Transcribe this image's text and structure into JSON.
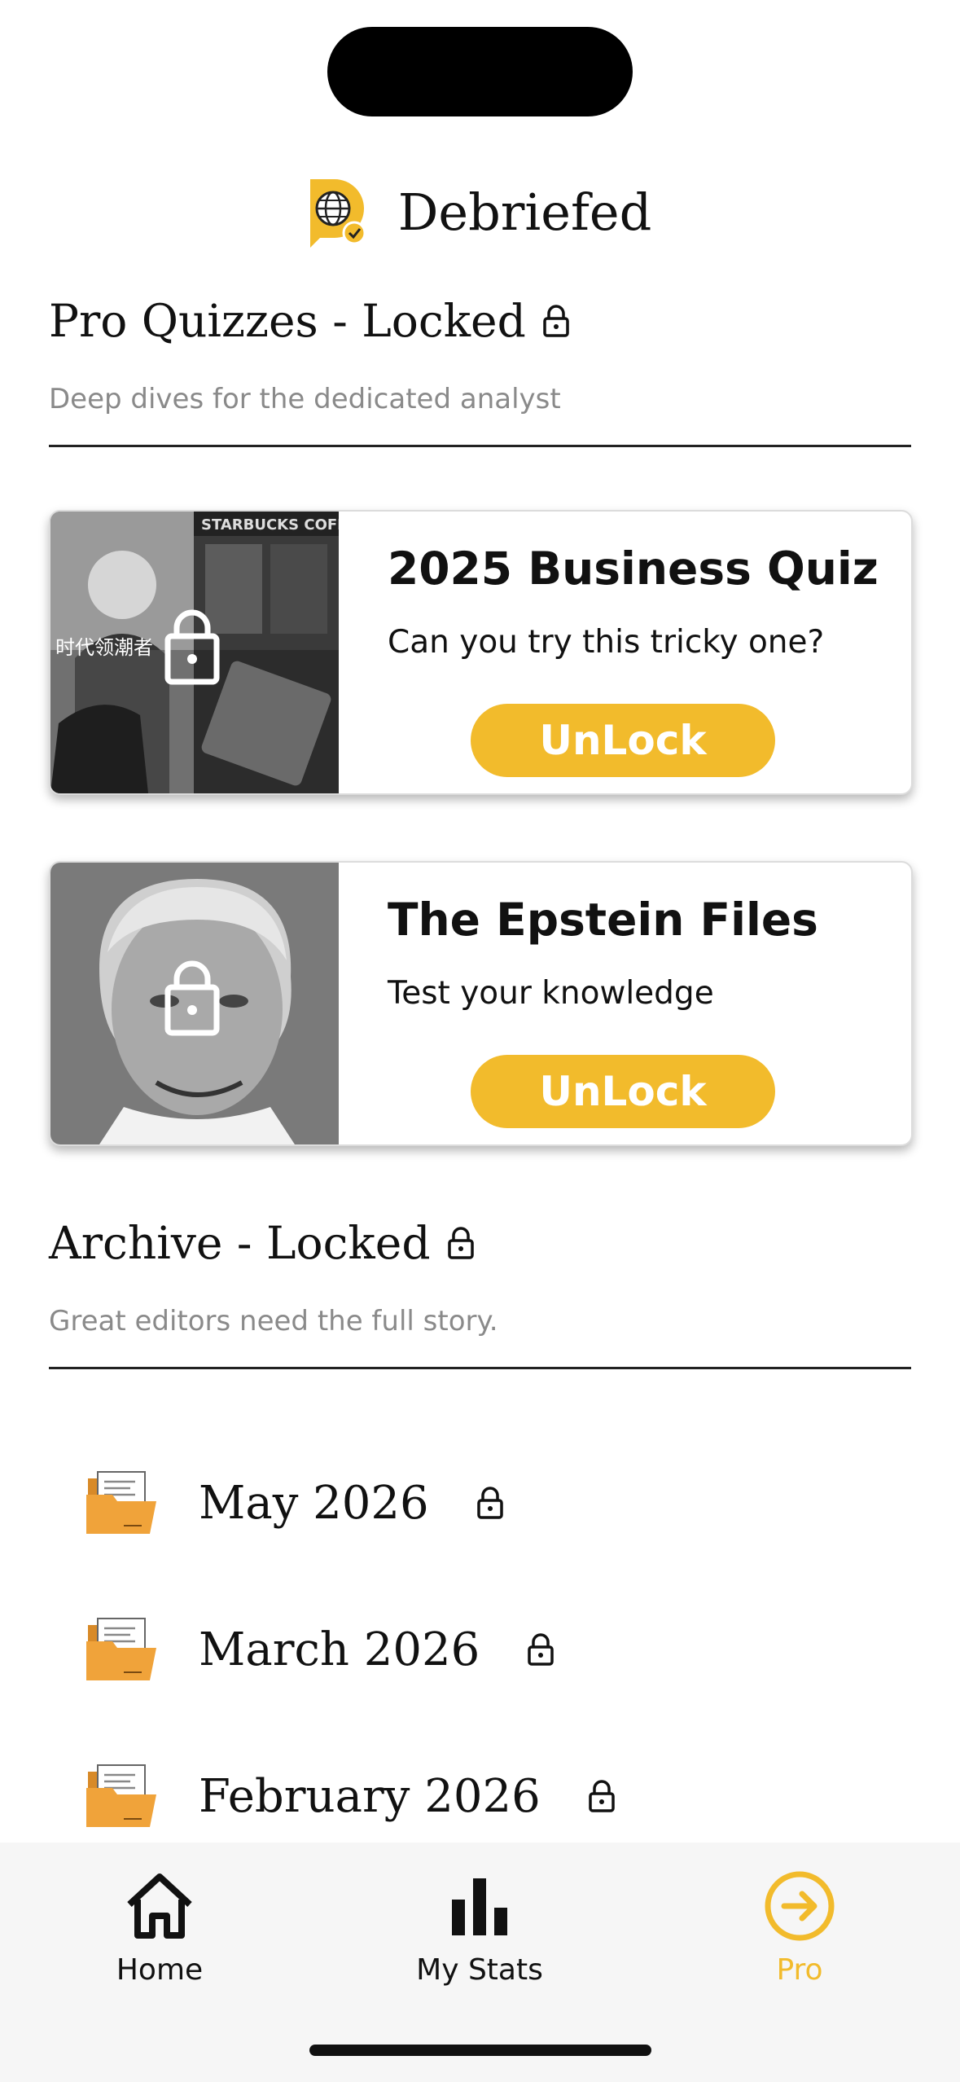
{
  "app": {
    "name": "Debriefed"
  },
  "pro_section": {
    "title": "Pro Quizzes - Locked",
    "subtitle": "Deep dives for the dedicated analyst",
    "cards": [
      {
        "title": "2025 Business Quiz",
        "description": "Can you try this tricky one?",
        "button_label": "UnLock"
      },
      {
        "title": "The Epstein Files",
        "description": "Test your knowledge",
        "button_label": "UnLock"
      }
    ]
  },
  "archive_section": {
    "title": "Archive - Locked",
    "subtitle": "Great editors need the full story.",
    "items": [
      {
        "label": "May 2026"
      },
      {
        "label": "March 2026"
      },
      {
        "label": "February 2026"
      }
    ]
  },
  "tabbar": {
    "tabs": [
      {
        "label": "Home",
        "icon": "home-icon"
      },
      {
        "label": "My Stats",
        "icon": "bar-chart-icon"
      },
      {
        "label": "Pro",
        "icon": "arrow-circle-right-icon",
        "active": true
      }
    ]
  },
  "colors": {
    "accent": "#f2bb2c",
    "folder": "#f0a33a",
    "text": "#111111",
    "muted": "#8a8a8a"
  }
}
